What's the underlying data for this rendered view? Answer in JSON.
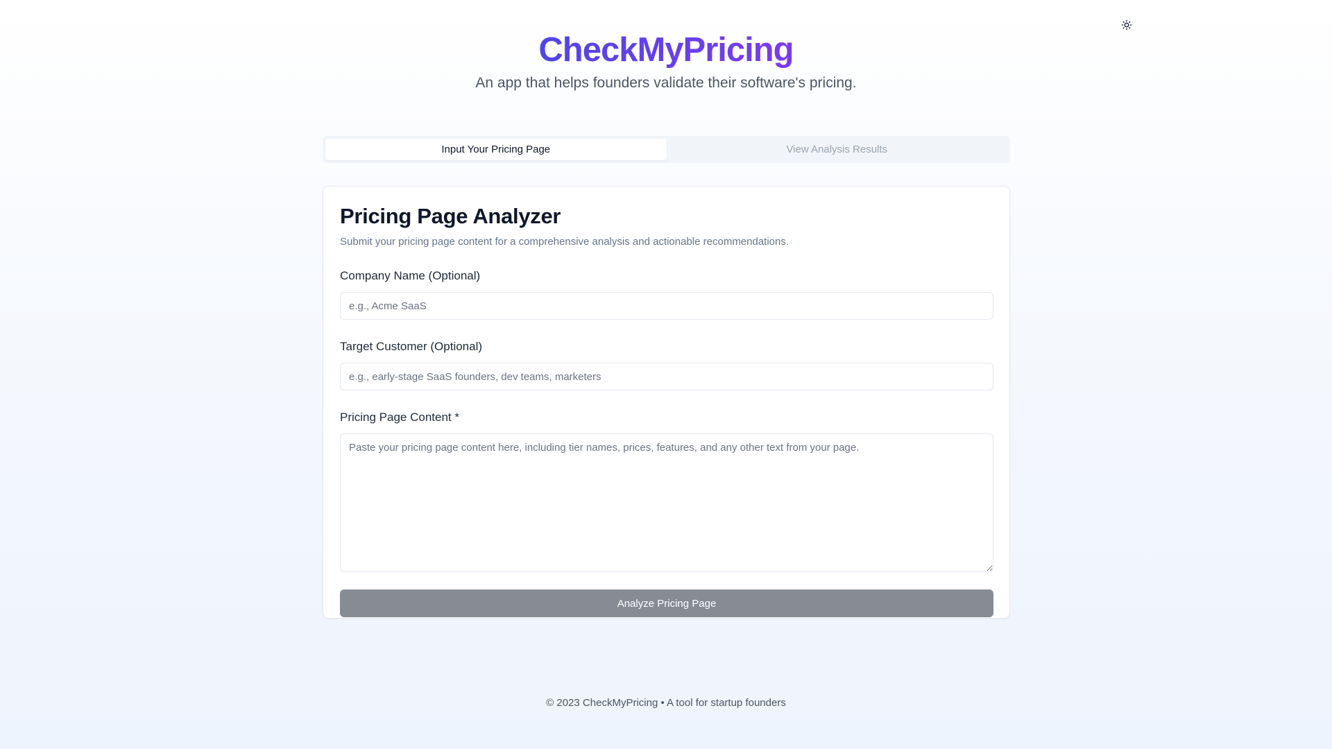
{
  "header": {
    "title": "CheckMyPricing",
    "subtitle": "An app that helps founders validate their software's pricing."
  },
  "theme_toggle": {
    "icon": "sun-icon"
  },
  "tabs": [
    {
      "label": "Input Your Pricing Page",
      "active": true
    },
    {
      "label": "View Analysis Results",
      "active": false
    }
  ],
  "card": {
    "title": "Pricing Page Analyzer",
    "description": "Submit your pricing page content for a comprehensive analysis and actionable recommendations.",
    "fields": {
      "company": {
        "label": "Company Name (Optional)",
        "placeholder": "e.g., Acme SaaS",
        "value": ""
      },
      "customer": {
        "label": "Target Customer (Optional)",
        "placeholder": "e.g., early-stage SaaS founders, dev teams, marketers",
        "value": ""
      },
      "content": {
        "label": "Pricing Page Content *",
        "placeholder": "Paste your pricing page content here, including tier names, prices, features, and any other text from your page.",
        "value": ""
      }
    },
    "submit_label": "Analyze Pricing Page"
  },
  "footer": {
    "text": "© 2023 CheckMyPricing • A tool for startup founders"
  },
  "colors": {
    "brand_start": "#4f46e5",
    "brand_end": "#7c3aed",
    "button_disabled": "#878b94"
  }
}
